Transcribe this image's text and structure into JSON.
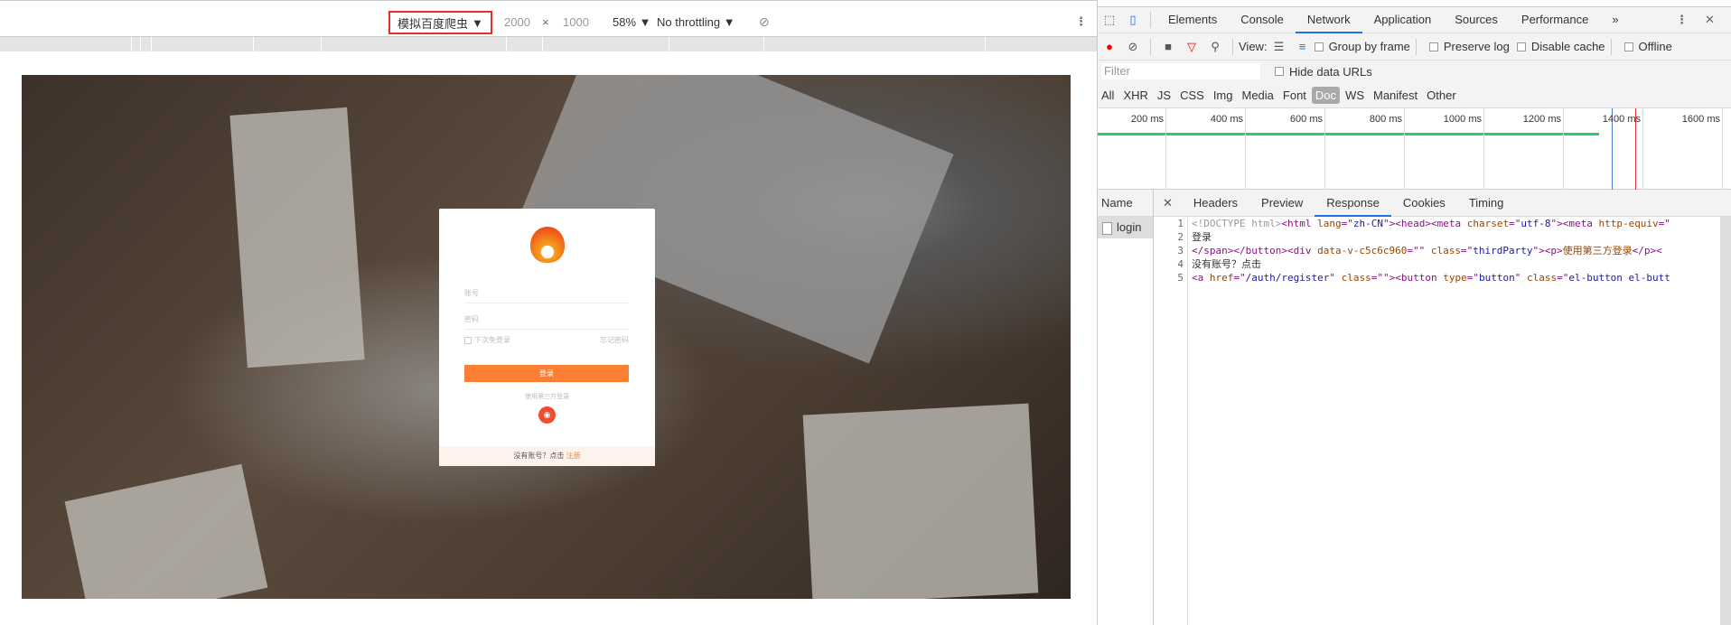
{
  "emulation": {
    "device": "模拟百度爬虫",
    "width": "2000",
    "times": "×",
    "height": "1000",
    "zoom": "58%",
    "throttling": "No throttling"
  },
  "login_card": {
    "account_placeholder": "账号",
    "password_placeholder": "密码",
    "remember": "下次免登录",
    "forgot": "忘记密码",
    "login_button": "登录",
    "third_party": "使用第三方登录",
    "no_account": "没有账号？点击",
    "register": "注册"
  },
  "devtools": {
    "tabs": [
      "Elements",
      "Console",
      "Network",
      "Application",
      "Sources",
      "Performance"
    ],
    "more": "»",
    "view_label": "View:",
    "group_by_frame": "Group by frame",
    "preserve_log": "Preserve log",
    "disable_cache": "Disable cache",
    "offline": "Offline",
    "filter_placeholder": "Filter",
    "hide_data_urls": "Hide data URLs",
    "types": [
      "All",
      "XHR",
      "JS",
      "CSS",
      "Img",
      "Media",
      "Font",
      "Doc",
      "WS",
      "Manifest",
      "Other"
    ],
    "timeline_ticks": [
      "200 ms",
      "400 ms",
      "600 ms",
      "800 ms",
      "1000 ms",
      "1200 ms",
      "1400 ms",
      "1600 ms"
    ],
    "name_header": "Name",
    "detail_tabs": [
      "Headers",
      "Preview",
      "Response",
      "Cookies",
      "Timing"
    ],
    "request": "login",
    "code_lines": [
      "1",
      "2",
      "3",
      "4",
      "5"
    ],
    "code": {
      "l1": [
        "<!DOCTYPE html>",
        "<html ",
        "lang",
        "=\"",
        "zh-CN",
        "\">",
        "<head>",
        "<meta ",
        "charset",
        "=\"",
        "utf-8",
        "\">",
        "<meta ",
        "http-equiv",
        "=\""
      ],
      "l2": "登录",
      "l3": [
        "</span></button><div ",
        "data-v-c5c6c960",
        "=\"\" ",
        "class",
        "=\"",
        "thirdParty",
        "\">",
        "<p>",
        "使用第三方登录",
        "</p><"
      ],
      "l4": "没有账号？点击",
      "l5": [
        "<a ",
        "href",
        "=\"",
        "/auth/register",
        "\" ",
        "class",
        "=\"\">",
        "<button ",
        "type",
        "=\"",
        "button",
        "\" ",
        "class",
        "=\"",
        "el-button el-butt"
      ]
    }
  }
}
